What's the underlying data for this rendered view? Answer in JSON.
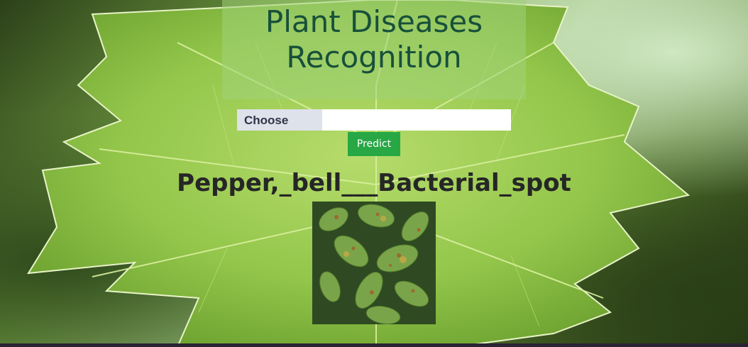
{
  "header": {
    "title": "Plant Diseases Recognition"
  },
  "upload": {
    "choose_label": "Choose",
    "file_value": ""
  },
  "actions": {
    "predict_label": "Predict"
  },
  "result": {
    "prediction": "Pepper,_bell___Bacterial_spot"
  },
  "colors": {
    "title_text": "#17503a",
    "predict_button": "#28a745",
    "choose_button": "#dee2ea"
  },
  "images": {
    "background": "leaf-background-photo",
    "preview": "uploaded-leaf-photo"
  }
}
